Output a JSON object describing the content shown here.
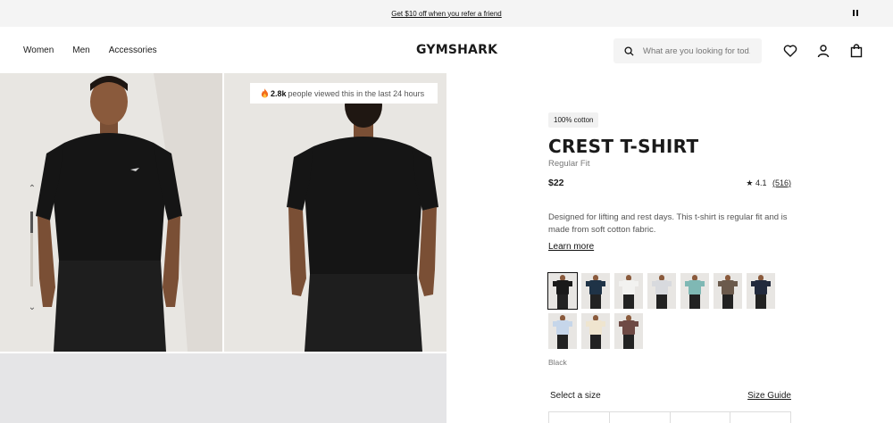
{
  "promo": {
    "text": "Get $10 off when you refer a friend"
  },
  "header": {
    "nav": [
      "Women",
      "Men",
      "Accessories"
    ],
    "logo": "GYMSHARK",
    "search": {
      "placeholder": "What are you looking for tod..."
    },
    "icons": [
      "search-icon",
      "heart-icon",
      "user-icon",
      "bag-icon"
    ]
  },
  "gallery": {
    "viewed_count": "2.8k",
    "viewed_text": "people viewed this in the last 24 hours",
    "thumb_progress": 0.29
  },
  "product": {
    "badge": "100% cotton",
    "title": "CREST T-SHIRT",
    "fit": "Regular Fit",
    "price": "$22",
    "rating_star": "★",
    "rating": "4.1",
    "review_count": "(516)",
    "description": "Designed for lifting and rest days. This t-shirt is regular fit and is made from soft cotton fabric.",
    "learn_more": "Learn more",
    "selected_color": "Black",
    "swatch_colors": [
      "#1a1a1a",
      "#1f3347",
      "#f2f2f0",
      "#d8dade",
      "#7fb8b4",
      "#6b5a4c",
      "#222a3d",
      "#c6d6ea",
      "#efe5cf",
      "#6e4a45"
    ]
  },
  "size": {
    "label": "Select a size",
    "guide": "Size Guide"
  }
}
